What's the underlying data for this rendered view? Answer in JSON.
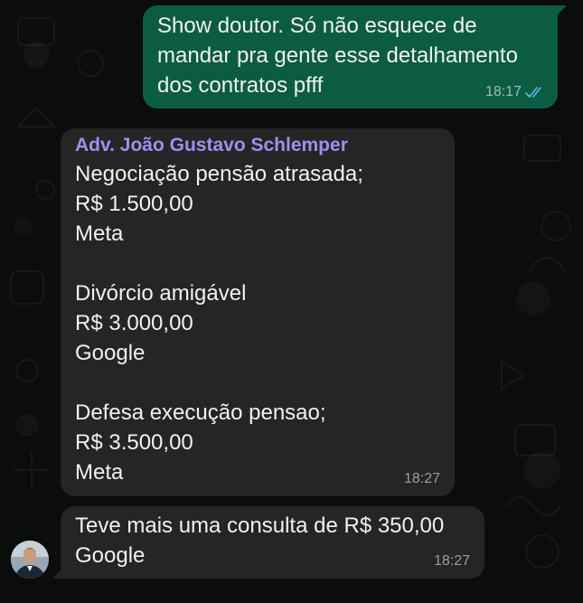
{
  "theme": {
    "background": "#0b0d0c",
    "outgoing_bubble": "#0b5c43",
    "incoming_bubble": "#232625",
    "sender_name_color": "#a58cf0",
    "read_receipt_color": "#53bdeb"
  },
  "messages": [
    {
      "direction": "outgoing",
      "lines": [
        "Show doutor. Só não esquece de",
        "mandar pra gente esse detalhamento",
        "dos contratos pfff"
      ],
      "time": "18:17",
      "status_icon": "double-check-read-icon"
    },
    {
      "direction": "incoming",
      "sender": "Adv. João Gustavo Schlemper",
      "lines": [
        "Negociação pensão atrasada;",
        "R$ 1.500,00",
        "Meta",
        "",
        "Divórcio amigável",
        "R$ 3.000,00",
        "Google",
        "",
        "Defesa execução pensao;",
        "R$ 3.500,00",
        "Meta"
      ],
      "time": "18:27"
    },
    {
      "direction": "incoming",
      "lines": [
        "Teve mais uma consulta de R$ 350,00",
        "Google"
      ],
      "time": "18:27",
      "avatar": "sender-avatar"
    }
  ]
}
